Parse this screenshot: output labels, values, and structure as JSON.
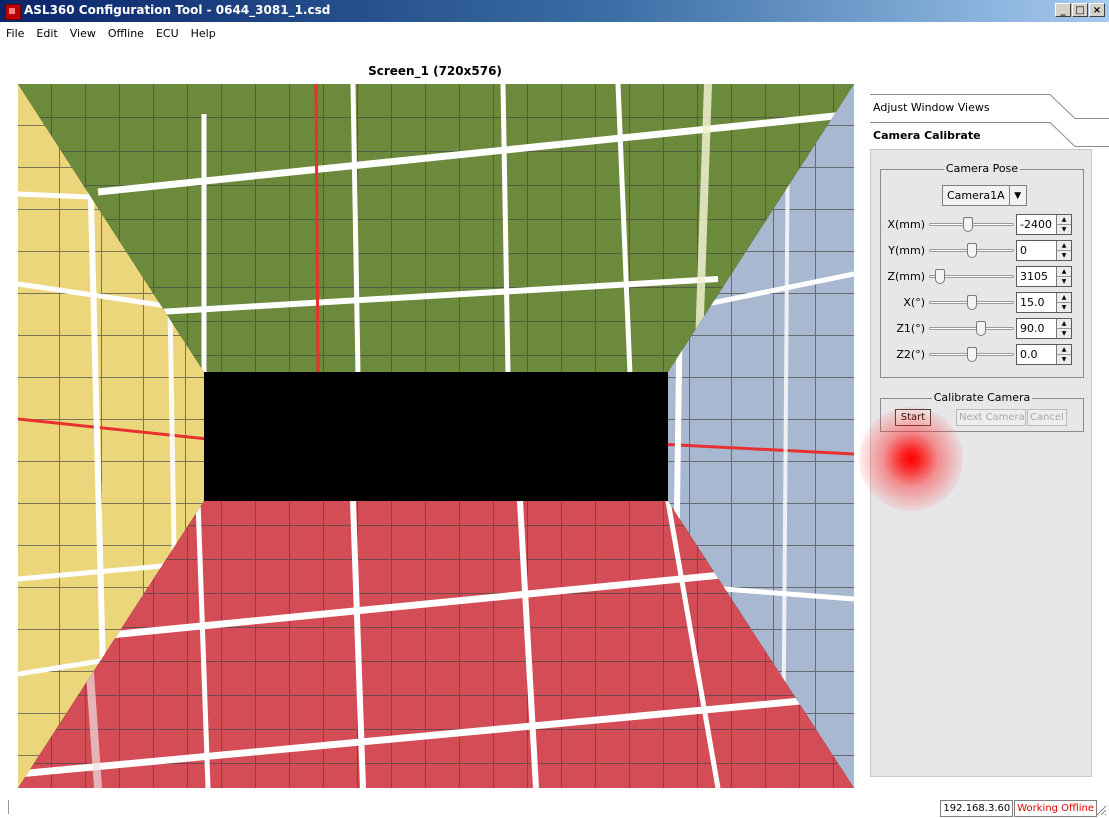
{
  "window": {
    "title": "ASL360 Configuration Tool - 0644_3081_1.csd",
    "icon": "app-logo-icon",
    "controls": [
      "_",
      "□",
      "×"
    ]
  },
  "menu": [
    "File",
    "Edit",
    "View",
    "Offline",
    "ECU",
    "Help"
  ],
  "screen": {
    "title": "Screen_1  (720x576)"
  },
  "tabs": {
    "adjust": "Adjust Window Views",
    "calibrate": "Camera Calibrate",
    "active": "Camera Calibrate"
  },
  "camera_pose": {
    "title": "Camera Pose",
    "camera_select": "Camera1A",
    "params": [
      {
        "label": "X(mm)",
        "value": "-2400",
        "level": 0.45
      },
      {
        "label": "Y(mm)",
        "value": "0",
        "level": 0.5
      },
      {
        "label": "Z(mm)",
        "value": "3105",
        "level": 0.08
      },
      {
        "label": "X(°)",
        "value": "15.0",
        "level": 0.5
      },
      {
        "label": "Z1(°)",
        "value": "90.0",
        "level": 0.62
      },
      {
        "label": "Z2(°)",
        "value": "0.0",
        "level": 0.5
      }
    ]
  },
  "calibrate_camera": {
    "title": "Calibrate Camera",
    "start": "Start",
    "next": "Next Camera",
    "cancel": "Cancel"
  },
  "status": {
    "ip": "192.168.3.60",
    "mode": "Working Offline"
  },
  "colors": {
    "floor_green": "#6b8a3c",
    "floor_red": "#d44c55",
    "floor_yellow": "#ecd67b",
    "floor_blue": "#a8b8d0",
    "center_black": "#000000",
    "offline_red": "#e00000"
  }
}
